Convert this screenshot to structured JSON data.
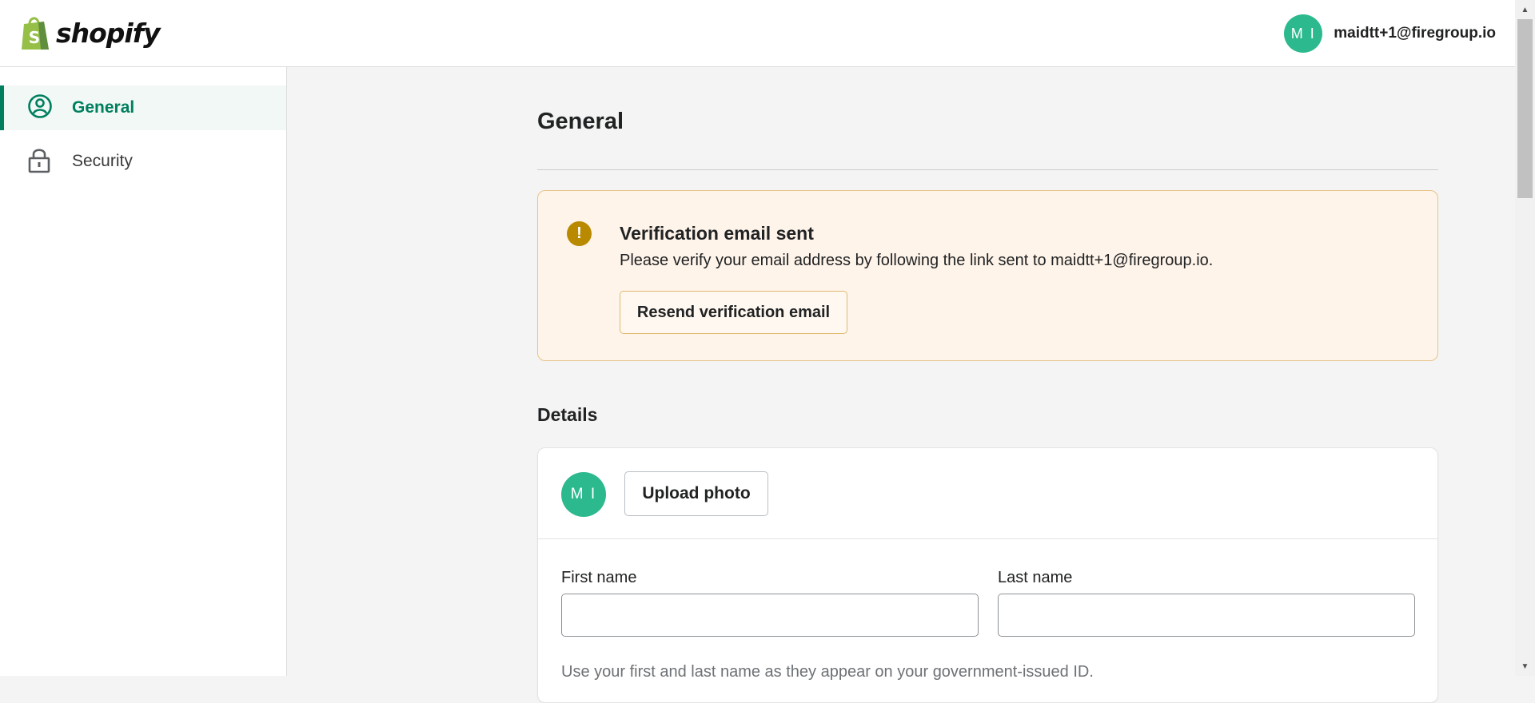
{
  "app": {
    "logo_text": "shopify"
  },
  "header": {
    "avatar_initials": "M I",
    "user_email": "maidtt+1@firegroup.io"
  },
  "sidebar": {
    "items": [
      {
        "label": "General",
        "icon": "user-circle-icon",
        "active": true
      },
      {
        "label": "Security",
        "icon": "lock-icon",
        "active": false
      }
    ]
  },
  "main": {
    "page_title": "General",
    "banner": {
      "icon": "alert-icon",
      "icon_glyph": "!",
      "title": "Verification email sent",
      "text": "Please verify your email address by following the link sent to maidtt+1@firegroup.io.",
      "button_label": "Resend verification email"
    },
    "details": {
      "section_title": "Details",
      "avatar_initials": "M I",
      "upload_button": "Upload photo",
      "first_name_label": "First name",
      "first_name_value": "",
      "last_name_label": "Last name",
      "last_name_value": "",
      "help_text": "Use your first and last name as they appear on your government-issued ID."
    }
  },
  "colors": {
    "brand_green": "#007f5f",
    "avatar_bg": "#2cb98e",
    "warning_bg": "#fff4ea",
    "warning_icon": "#b98900"
  }
}
